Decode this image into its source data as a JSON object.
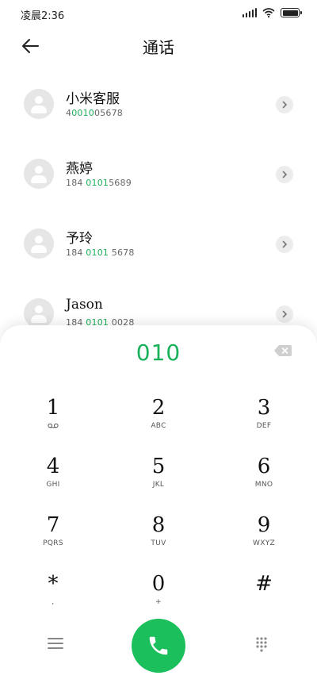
{
  "status_bar": {
    "time": "凌晨2:36"
  },
  "header": {
    "title": "通话"
  },
  "contacts": [
    {
      "name": "小米客服",
      "number_pre": "4",
      "number_match": "0010",
      "number_post": "05678"
    },
    {
      "name": "燕婷",
      "number_pre": "184 ",
      "number_match": "0101",
      "number_post": "5689"
    },
    {
      "name": "予玲",
      "number_pre": "184 ",
      "number_match": "0101",
      "number_post": " 5678"
    },
    {
      "name": "Jason",
      "number_pre": "184 ",
      "number_match": "0101",
      "number_post": " 0028"
    }
  ],
  "dialer": {
    "dialed_number": "010",
    "keys": [
      {
        "digit": "1",
        "letters": ""
      },
      {
        "digit": "2",
        "letters": "ABC"
      },
      {
        "digit": "3",
        "letters": "DEF"
      },
      {
        "digit": "4",
        "letters": "GHI"
      },
      {
        "digit": "5",
        "letters": "JKL"
      },
      {
        "digit": "6",
        "letters": "MNO"
      },
      {
        "digit": "7",
        "letters": "PQRS"
      },
      {
        "digit": "8",
        "letters": "TUV"
      },
      {
        "digit": "9",
        "letters": "WXYZ"
      },
      {
        "digit": "*",
        "letters": ","
      },
      {
        "digit": "0",
        "letters": "+"
      },
      {
        "digit": "#",
        "letters": ""
      }
    ]
  },
  "colors": {
    "accent": "#1bb05a",
    "call_button": "#1bbf5b"
  },
  "icons": [
    "back-arrow-icon",
    "chevron-right-icon",
    "backspace-icon",
    "voicemail-icon",
    "menu-icon",
    "phone-icon",
    "dialpad-icon"
  ]
}
